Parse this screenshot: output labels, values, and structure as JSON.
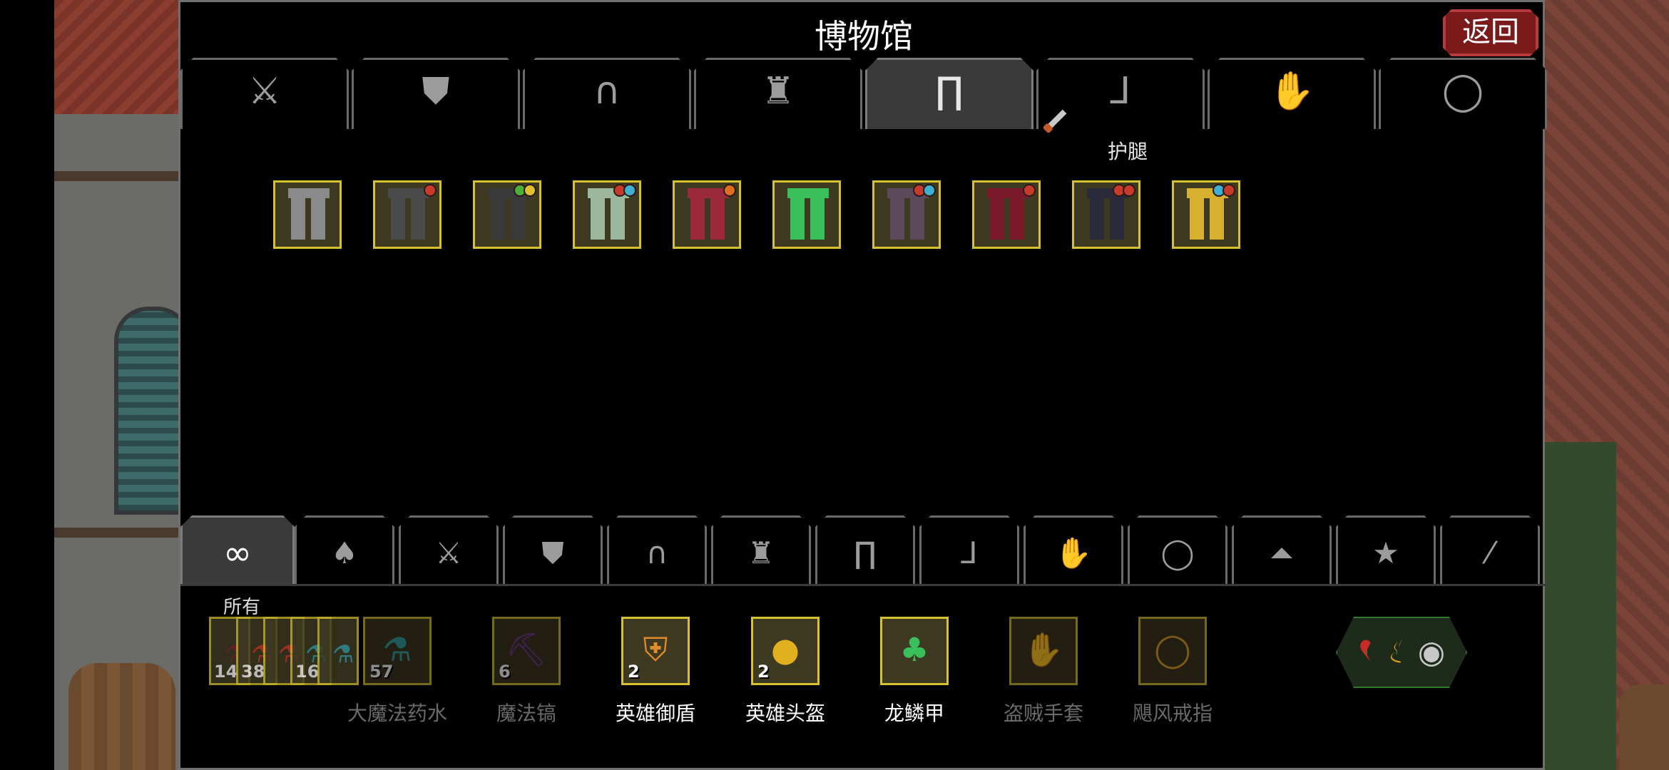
{
  "title": "博物馆",
  "back_button": "返回",
  "top_tabs": [
    {
      "icon": "sword-icon",
      "glyph": "⚔",
      "active": false
    },
    {
      "icon": "shield-icon",
      "glyph": "⛊",
      "active": false
    },
    {
      "icon": "helmet-icon",
      "glyph": "∩",
      "active": false
    },
    {
      "icon": "armor-icon",
      "glyph": "♜",
      "active": false
    },
    {
      "icon": "greaves-icon",
      "glyph": "∏",
      "active": true
    },
    {
      "icon": "boots-icon",
      "glyph": "⅃",
      "active": false
    },
    {
      "icon": "gloves-icon",
      "glyph": "✋",
      "active": false
    },
    {
      "icon": "ring-icon",
      "glyph": "◯",
      "active": false
    }
  ],
  "active_tab_tooltip": "护腿",
  "museum_items": [
    {
      "name": "chainmail-greaves",
      "color": "#8a8a8a",
      "gems": []
    },
    {
      "name": "dark-chain-greaves",
      "color": "#4a4a4a",
      "gems": [
        "#c83a2a"
      ]
    },
    {
      "name": "black-greaves",
      "color": "#3a3a3a",
      "gems": [
        "#4caf3a",
        "#e0c030"
      ]
    },
    {
      "name": "sage-greaves",
      "color": "#9cb89c",
      "gems": [
        "#c83a2a",
        "#40b0d0"
      ]
    },
    {
      "name": "crimson-greaves",
      "color": "#9a2a3a",
      "gems": [
        "#e07020"
      ]
    },
    {
      "name": "emerald-greaves",
      "color": "#3ac05a",
      "gems": []
    },
    {
      "name": "shadow-greaves",
      "color": "#5a4a5a",
      "gems": [
        "#c83a2a",
        "#40b0d0"
      ]
    },
    {
      "name": "blood-greaves",
      "color": "#7a1a2a",
      "gems": [
        "#c83a2a"
      ]
    },
    {
      "name": "obsidian-greaves",
      "color": "#2a2a3a",
      "gems": [
        "#c83a2a",
        "#c83a2a"
      ]
    },
    {
      "name": "golden-greaves",
      "color": "#d8b030",
      "gems": [
        "#40b0d0",
        "#c83a2a"
      ]
    }
  ],
  "bottom_tabs": [
    {
      "icon": "infinity-icon",
      "glyph": "∞",
      "active": true
    },
    {
      "icon": "bag-icon",
      "glyph": "♠",
      "active": false
    },
    {
      "icon": "sword-icon",
      "glyph": "⚔",
      "active": false
    },
    {
      "icon": "shield-icon",
      "glyph": "⛊",
      "active": false
    },
    {
      "icon": "helmet-icon",
      "glyph": "∩",
      "active": false
    },
    {
      "icon": "armor-icon",
      "glyph": "♜",
      "active": false
    },
    {
      "icon": "greaves-icon",
      "glyph": "∏",
      "active": false
    },
    {
      "icon": "boots-icon",
      "glyph": "⅃",
      "active": false
    },
    {
      "icon": "gloves-icon",
      "glyph": "✋",
      "active": false
    },
    {
      "icon": "ring-icon",
      "glyph": "◯",
      "active": false
    },
    {
      "icon": "cape-icon",
      "glyph": "⏶",
      "active": false
    },
    {
      "icon": "star-icon",
      "glyph": "★",
      "active": false
    },
    {
      "icon": "wand-icon",
      "glyph": "⁄",
      "active": false
    }
  ],
  "bottom_tab_label": "所有",
  "potion_stack": [
    {
      "count": "14"
    },
    {
      "count": "38"
    },
    {
      "count": ""
    },
    {
      "count": "16"
    },
    {
      "count": ""
    }
  ],
  "bottom_items": [
    {
      "label": "大魔法药水",
      "count": "57",
      "art": "⚗",
      "art_color": "#3aa0a0",
      "dim": true
    },
    {
      "label": "魔法镐",
      "count": "6",
      "art": "⛏",
      "art_color": "#7a3aa0",
      "dim": true
    },
    {
      "label": "英雄御盾",
      "count": "2",
      "art": "⛨",
      "art_color": "#e08a2a",
      "dim": false
    },
    {
      "label": "英雄头盔",
      "count": "2",
      "art": "●",
      "art_color": "#e0b020",
      "dim": false
    },
    {
      "label": "龙鳞甲",
      "count": "",
      "art": "♣",
      "art_color": "#3ac05a",
      "dim": false
    },
    {
      "label": "盗贼手套",
      "count": "",
      "art": "✋",
      "art_color": "#8a8a8a",
      "dim": true
    },
    {
      "label": "飓风戒指",
      "count": "",
      "art": "◯",
      "art_color": "#e0a030",
      "dim": true
    }
  ],
  "hex_items": [
    {
      "icon": "heart-icon",
      "glyph": "♥",
      "color": "#c82a2a"
    },
    {
      "icon": "fire-icon",
      "glyph": "♨",
      "color": "#e0a020"
    },
    {
      "icon": "eye-icon",
      "glyph": "◉",
      "color": "#c8c8c8"
    }
  ]
}
